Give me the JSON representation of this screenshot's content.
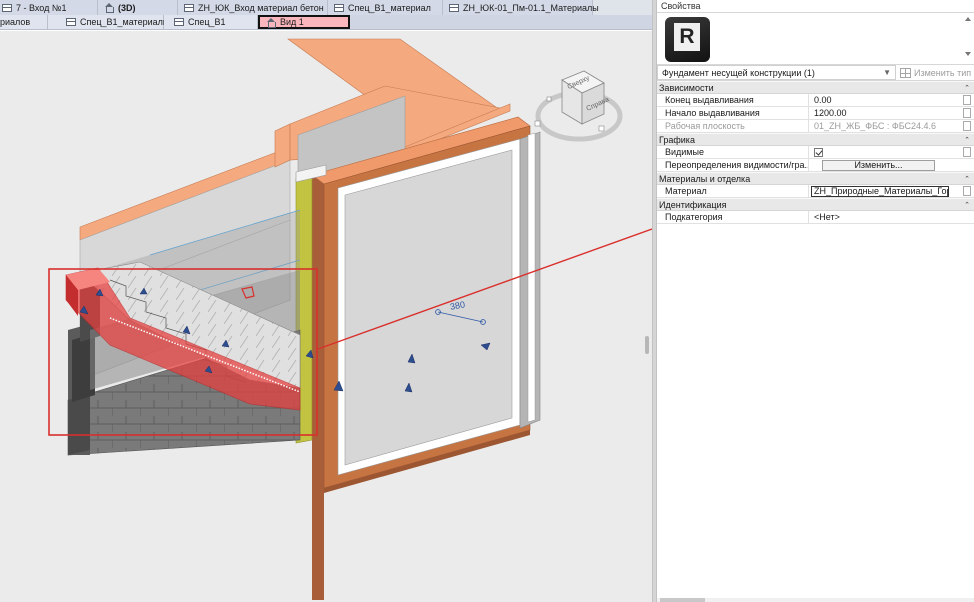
{
  "tabs_row1": [
    {
      "label": "7 - Вход №1",
      "icon": "view-tab-icon"
    },
    {
      "label": "(3D)",
      "icon": "house-icon",
      "bold": true
    },
    {
      "label": "ZH_ЮК_Вход материал бетон",
      "icon": "schedule-icon"
    },
    {
      "label": "Спец_В1_материал",
      "icon": "schedule-icon"
    },
    {
      "label": "ZH_ЮК-01_Пм-01.1_Материалы",
      "icon": "schedule-icon"
    }
  ],
  "tabs_row2": [
    {
      "label": "риалов",
      "icon": ""
    },
    {
      "label": "Спец_В1_материалы",
      "icon": "schedule-icon"
    },
    {
      "label": "Спец_В1",
      "icon": "schedule-icon"
    },
    {
      "label": "Вид 1",
      "icon": "house-icon",
      "active": true
    }
  ],
  "viewcube": {
    "top_face": "Сверху",
    "right_face": "Справа"
  },
  "dimension": {
    "value": "380"
  },
  "properties": {
    "title": "Свойства",
    "type_name": "Фундамент несущей конструкции (1)",
    "edit_type_label": "Изменить тип",
    "groups": {
      "constraints": {
        "title": "Зависимости",
        "rows": [
          {
            "name": "Конец выдавливания",
            "value": "0.00"
          },
          {
            "name": "Начало выдавливания",
            "value": "1200.00"
          },
          {
            "name": "Рабочая плоскость",
            "value": "01_ZH_ЖБ_ФБС : ФБС24.4.6"
          }
        ]
      },
      "graphics": {
        "title": "Графика",
        "visible_label": "Видимые",
        "overrides_label": "Переопределения видимости/гра...",
        "overrides_button": "Изменить..."
      },
      "materials": {
        "title": "Материалы и отделка",
        "material_label": "Материал",
        "material_value": "ZH_Природные_Материалы_Гор"
      },
      "identity": {
        "title": "Идентификация",
        "subcategory_label": "Подкатегория",
        "subcategory_value": "<Нет>"
      }
    }
  },
  "colors": {
    "highlight_red": "#e83f3f",
    "annotation_red": "#d9302c",
    "wall_orange": "#f5a97e",
    "brick_brown": "#b5673f",
    "active_tab": "#f9b6bc",
    "insulation_green": "#c2c441"
  }
}
